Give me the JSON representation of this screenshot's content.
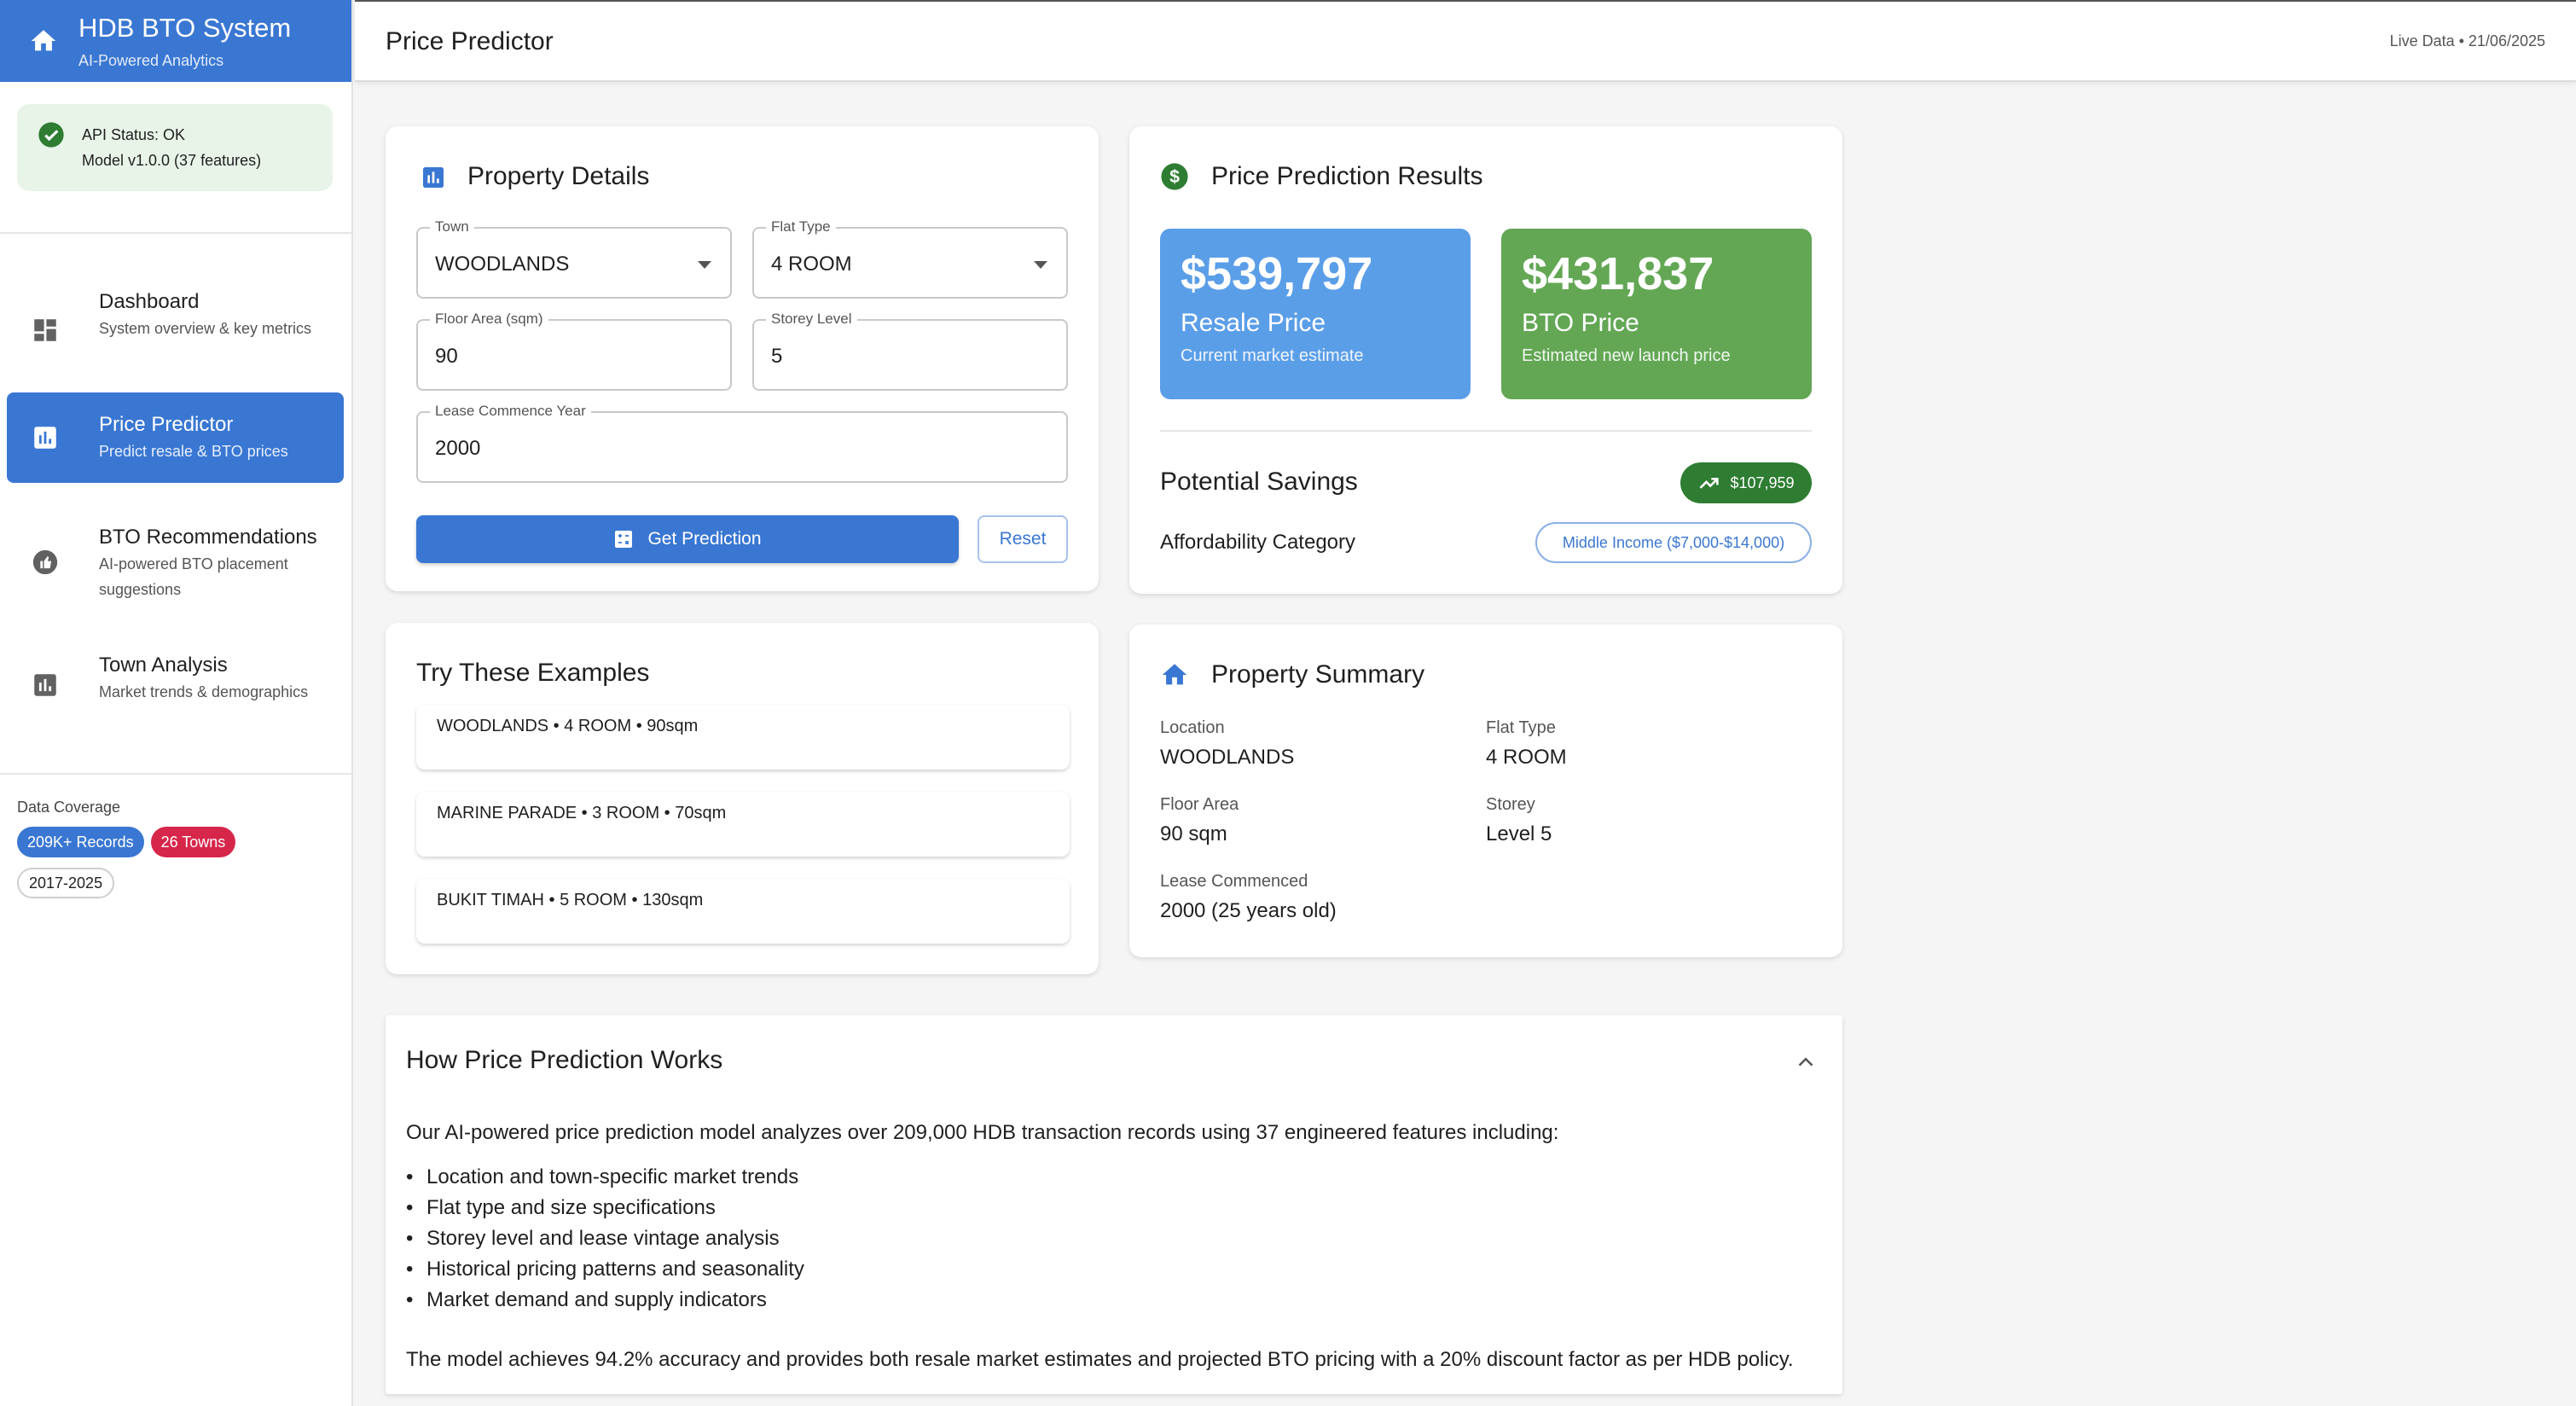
{
  "app": {
    "title": "HDB BTO System",
    "subtitle": "AI-Powered Analytics"
  },
  "api_status": {
    "line1": "API Status: OK",
    "line2": "Model v1.0.0 (37 features)"
  },
  "nav": [
    {
      "label": "Dashboard",
      "desc": "System overview & key metrics"
    },
    {
      "label": "Price Predictor",
      "desc": "Predict resale & BTO prices"
    },
    {
      "label": "BTO Recommendations",
      "desc": "AI-powered BTO placement suggestions"
    },
    {
      "label": "Town Analysis",
      "desc": "Market trends & demographics"
    }
  ],
  "coverage": {
    "caption": "Data Coverage",
    "chips": [
      "209K+ Records",
      "26 Towns",
      "2017-2025"
    ]
  },
  "header": {
    "title": "Price Predictor",
    "live": "Live Data • 21/06/2025"
  },
  "property_details": {
    "title": "Property Details",
    "town": {
      "label": "Town",
      "value": "WOODLANDS"
    },
    "flat_type": {
      "label": "Flat Type",
      "value": "4 ROOM"
    },
    "floor_area": {
      "label": "Floor Area (sqm)",
      "value": "90"
    },
    "storey": {
      "label": "Storey Level",
      "value": "5"
    },
    "lease": {
      "label": "Lease Commence Year",
      "value": "2000"
    },
    "predict_button": "Get Prediction",
    "reset_button": "Reset"
  },
  "examples": {
    "title": "Try These Examples",
    "items": [
      "WOODLANDS • 4 ROOM • 90sqm",
      "MARINE PARADE • 3 ROOM • 70sqm",
      "BUKIT TIMAH • 5 ROOM • 130sqm"
    ]
  },
  "results": {
    "title": "Price Prediction Results",
    "resale": {
      "amount": "$539,797",
      "label": "Resale Price",
      "sub": "Current market estimate",
      "color": "#5b9ee8"
    },
    "bto": {
      "amount": "$431,837",
      "label": "BTO Price",
      "sub": "Estimated new launch price",
      "color": "#63a755"
    },
    "savings_label": "Potential Savings",
    "savings_value": "$107,959",
    "afford_label": "Affordability Category",
    "afford_value": "Middle Income ($7,000-$14,000)"
  },
  "summary": {
    "title": "Property Summary",
    "location_label": "Location",
    "location": "WOODLANDS",
    "flat_type_label": "Flat Type",
    "flat_type": "4 ROOM",
    "floor_area_label": "Floor Area",
    "floor_area": "90 sqm",
    "storey_label": "Storey",
    "storey": "Level 5",
    "lease_label": "Lease Commenced",
    "lease": "2000 (25 years old)"
  },
  "how": {
    "title": "How Price Prediction Works",
    "intro": "Our AI-powered price prediction model analyzes over 209,000 HDB transaction records using 37 engineered features including:",
    "bullets": [
      "Location and town-specific market trends",
      "Flat type and size specifications",
      "Storey level and lease vintage analysis",
      "Historical pricing patterns and seasonality",
      "Market demand and supply indicators"
    ],
    "outro": "The model achieves 94.2% accuracy and provides both resale market estimates and projected BTO pricing with a 20% discount factor as per HDB policy."
  }
}
